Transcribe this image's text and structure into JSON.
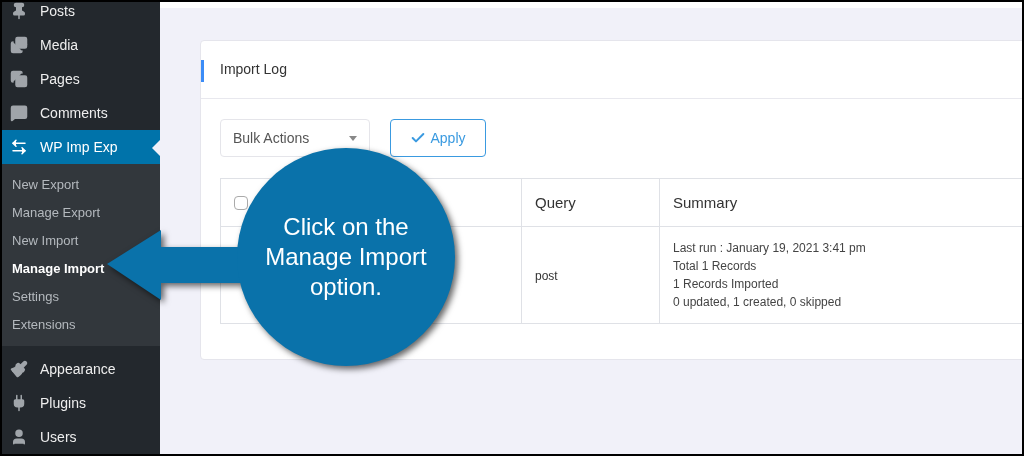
{
  "sidebar": {
    "items": [
      {
        "label": "Posts",
        "selected": false
      },
      {
        "label": "Media",
        "selected": false
      },
      {
        "label": "Pages",
        "selected": false
      },
      {
        "label": "Comments",
        "selected": false
      },
      {
        "label": "WP Imp Exp",
        "selected": true,
        "children": [
          {
            "label": "New Export",
            "selected": false
          },
          {
            "label": "Manage Export",
            "selected": false
          },
          {
            "label": "New Import",
            "selected": false
          },
          {
            "label": "Manage Import",
            "selected": true
          },
          {
            "label": "Settings",
            "selected": false
          },
          {
            "label": "Extensions",
            "selected": false
          }
        ]
      },
      {
        "label": "Appearance",
        "selected": false
      },
      {
        "label": "Plugins",
        "selected": false
      },
      {
        "label": "Users",
        "selected": false
      }
    ]
  },
  "card": {
    "title": "Import Log",
    "bulk_actions": {
      "value": "Bulk Actions"
    },
    "apply_button": "Apply",
    "table": {
      "select_all": {
        "checked": false
      },
      "columns": [
        "Query",
        "Summary"
      ],
      "rows": [
        {
          "query": "post",
          "summary": [
            "Last run : January 19, 2021 3:41 pm",
            "Total 1 Records",
            "1 Records Imported",
            "0 updated, 1 created, 0 skipped"
          ]
        }
      ]
    }
  },
  "callout": {
    "text": "Click on the Manage Import option."
  }
}
